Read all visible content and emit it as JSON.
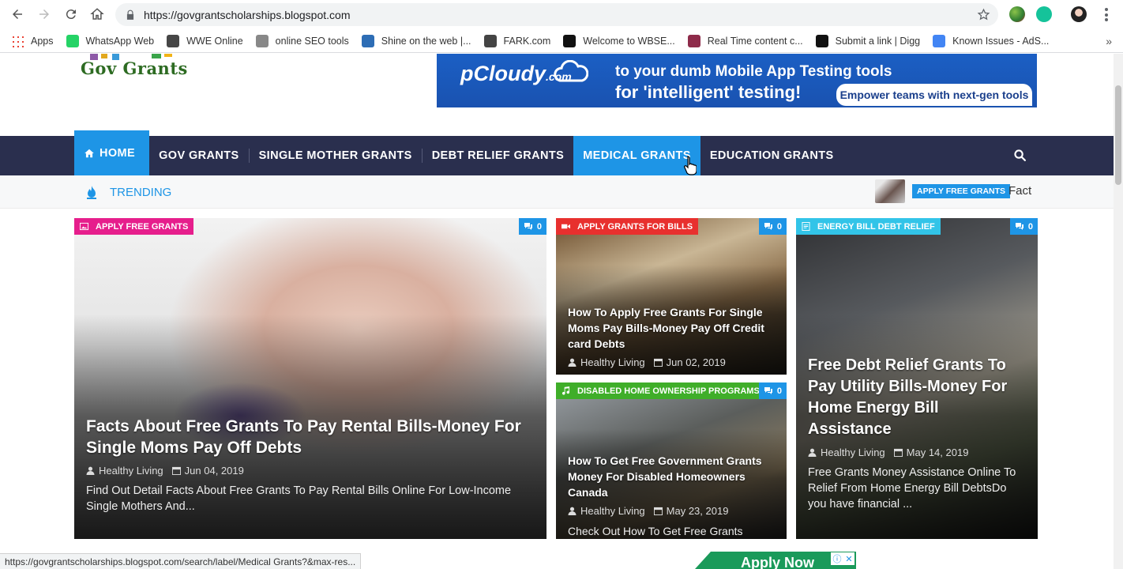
{
  "browser": {
    "url": "https://govgrantscholarships.blogspot.com",
    "bookmarks": [
      {
        "label": "Apps",
        "icon": "apps-grid-icon",
        "color": "#ea4335"
      },
      {
        "label": "WhatsApp Web",
        "icon": "whatsapp-icon",
        "color": "#25d366"
      },
      {
        "label": "WWE Online",
        "icon": "wordpress-icon",
        "color": "#464646"
      },
      {
        "label": "online SEO tools",
        "icon": "sst-icon",
        "color": "#888888"
      },
      {
        "label": "Shine on the web |...",
        "icon": "shine-icon",
        "color": "#2d6db5"
      },
      {
        "label": "FARK.com",
        "icon": "fark-icon",
        "color": "#444444"
      },
      {
        "label": "Welcome to WBSE...",
        "icon": "wbse-icon",
        "color": "#111111"
      },
      {
        "label": "Real Time content c...",
        "icon": "realtime-icon",
        "color": "#8e2b4a"
      },
      {
        "label": "Submit a link | Digg",
        "icon": "digg-icon",
        "color": "#111111"
      },
      {
        "label": "Known Issues - AdS...",
        "icon": "google-icon",
        "color": "#4285f4"
      }
    ],
    "status_url": "https://govgrantscholarships.blogspot.com/search/label/Medical Grants?&max-res..."
  },
  "site": {
    "logo_text": "Gov Grants",
    "ad": {
      "brand": "pCloudy",
      "brand_suffix": ".com",
      "line1": "to your dumb Mobile App Testing tools",
      "line2": "for 'intelligent' testing!",
      "cta": "Empower teams with next-gen tools"
    },
    "nav": {
      "home": "HOME",
      "items": [
        "GOV GRANTS",
        "SINGLE MOTHER GRANTS",
        "DEBT RELIEF GRANTS",
        "MEDICAL GRANTS",
        "EDUCATION GRANTS"
      ]
    },
    "trending": {
      "label": "TRENDING",
      "badge": "APPLY FREE GRANTS",
      "text": "Fact"
    }
  },
  "colors": {
    "nav_bg": "#2a2f4e",
    "accent": "#1e95e6",
    "cat_pink": "#e61e8c",
    "cat_red": "#e8302e",
    "cat_green": "#3fae29",
    "cat_cyan": "#32c4e8"
  },
  "cards": [
    {
      "category": "APPLY FREE GRANTS",
      "comments": "0",
      "title": "Facts About Free Grants To Pay Rental Bills-Money For Single Moms Pay Off Debts",
      "author": "Healthy Living",
      "date": "Jun 04, 2019",
      "excerpt": "Find Out Detail Facts About Free Grants To Pay Rental Bills Online For Low-Income Single Mothers And..."
    },
    {
      "category": "APPLY GRANTS FOR BILLS",
      "comments": "0",
      "title": "How To Apply Free Grants For Single Moms Pay Bills-Money Pay Off Credit card Debts",
      "author": "Healthy Living",
      "date": "Jun 02, 2019"
    },
    {
      "category": "DISABLED HOME OWNERSHIP PROGRAMS",
      "comments": "0",
      "title": "How To Get Free Government Grants Money For Disabled Homeowners Canada",
      "author": "Healthy Living",
      "date": "May 23, 2019",
      "excerpt": "Check Out How To Get Free Grants"
    },
    {
      "category": "ENERGY BILL DEBT RELIEF",
      "comments": "0",
      "title": "Free Debt Relief Grants To Pay Utility Bills-Money For Home Energy Bill Assistance",
      "author": "Healthy Living",
      "date": "May 14, 2019",
      "excerpt": "Free Grants Money Assistance Online To Relief From Home Energy Bill DebtsDo you have financial ..."
    }
  ],
  "floating_ad": {
    "label": "Apply Now"
  }
}
